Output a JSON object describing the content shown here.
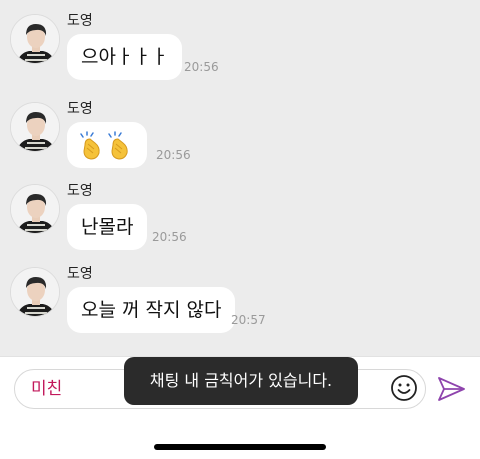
{
  "messages": [
    {
      "sender": "도영",
      "text": "으아ㅏㅏㅏ",
      "time": "20:56"
    },
    {
      "sender": "도영",
      "text": "",
      "emoji": "clapping-hands",
      "time": "20:56"
    },
    {
      "sender": "도영",
      "text": "난몰라",
      "time": "20:56"
    },
    {
      "sender": "도영",
      "text": "오늘 꺼 작지 않다",
      "time": "20:57"
    }
  ],
  "input": {
    "value": "미친",
    "value_color": "#c2185b"
  },
  "toast": {
    "text": "채팅 내 금칙어가 있습니다."
  },
  "icons": {
    "emoji_button": "smiley-icon",
    "send_button": "send-icon"
  },
  "colors": {
    "chat_background": "#ececec",
    "bubble": "#ffffff",
    "accent": "#8e44ad",
    "toast_background": "#2b2b2b"
  }
}
